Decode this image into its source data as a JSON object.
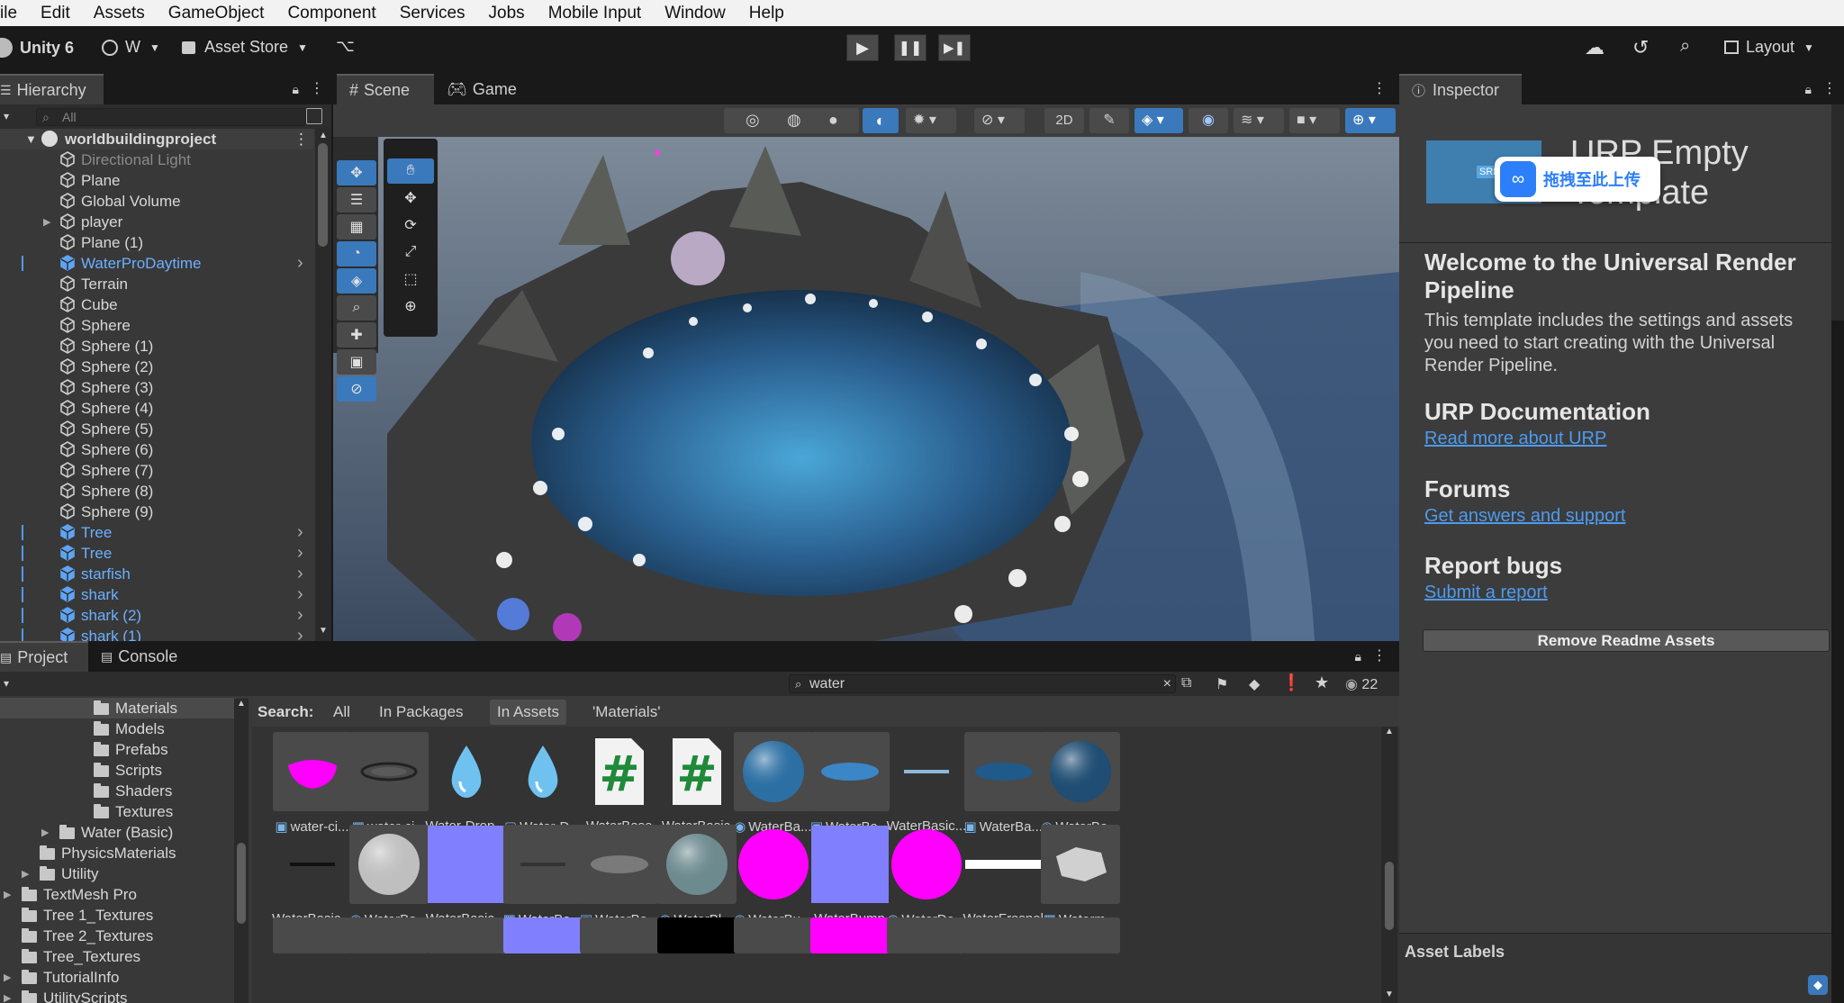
{
  "menu": [
    "ile",
    "Edit",
    "Assets",
    "GameObject",
    "Component",
    "Services",
    "Jobs",
    "Mobile Input",
    "Window",
    "Help"
  ],
  "toolbar": {
    "unity": "Unity 6",
    "account": "W",
    "asset_store": "Asset Store",
    "layout": "Layout"
  },
  "hierarchy": {
    "tab": "Hierarchy",
    "search_placeholder": "All",
    "root": "worldbuildingproject",
    "items": [
      "Directional Light",
      "Plane",
      "Global Volume",
      "player",
      "Plane (1)",
      "WaterProDaytime",
      "Terrain",
      "Cube",
      "Sphere",
      "Sphere (1)",
      "Sphere (2)",
      "Sphere (3)",
      "Sphere (4)",
      "Sphere (5)",
      "Sphere (6)",
      "Sphere (7)",
      "Sphere (8)",
      "Sphere (9)",
      "Tree",
      "Tree",
      "starfish",
      "shark",
      "shark (2)",
      "shark (1)"
    ]
  },
  "scene": {
    "tab_scene": "Scene",
    "tab_game": "Game"
  },
  "inspector": {
    "tab": "Inspector",
    "title": "URP Empty Template",
    "upload_badge": "拖拽至此上传",
    "srp": "SRP",
    "welcome_title": "Welcome to the Universal Render Pipeline",
    "welcome_text": "This template includes the settings and assets you need to start creating with the Universal Render Pipeline.",
    "doc_title": "URP Documentation",
    "doc_link": "Read more about URP",
    "forums_title": "Forums",
    "forums_link": "Get answers and support",
    "bugs_title": "Report bugs",
    "bugs_link": "Submit a report",
    "remove_btn": "Remove Readme Assets",
    "asset_labels": "Asset Labels"
  },
  "project": {
    "tab_project": "Project",
    "tab_console": "Console",
    "search_value": "water",
    "hidden_count": "22",
    "search_label": "Search:",
    "filters": [
      "All",
      "In Packages",
      "In Assets",
      "'Materials'"
    ],
    "folders": [
      "Materials",
      "Models",
      "Prefabs",
      "Scripts",
      "Shaders",
      "Textures",
      "Water (Basic)",
      "PhysicsMaterials",
      "Utility",
      "TextMesh Pro",
      "Tree 1_Textures",
      "Tree 2_Textures",
      "Tree_Textures",
      "TutorialInfo",
      "UtilityScripts"
    ],
    "row1": [
      "water-ci...",
      "water-ci...",
      "Water-Drop...",
      "Water-D...",
      "WaterBase",
      "WaterBasic",
      "WaterBa...",
      "WaterBa...",
      "WaterBasic...",
      "WaterBa...",
      "WaterBa..."
    ],
    "row2": [
      "WaterBasic...",
      "WaterBa...",
      "WaterBasic...",
      "WaterBa...",
      "WaterBa...",
      "WaterBl...",
      "WaterBu...",
      "WaterBump",
      "WaterDe...",
      "WaterFresnel",
      "Waterm..."
    ]
  },
  "colors": {
    "accent_blue": "#3a79bb",
    "link_blue": "#4d9bee",
    "magenta": "#ff00ff",
    "normal_map": "#8080ff"
  }
}
